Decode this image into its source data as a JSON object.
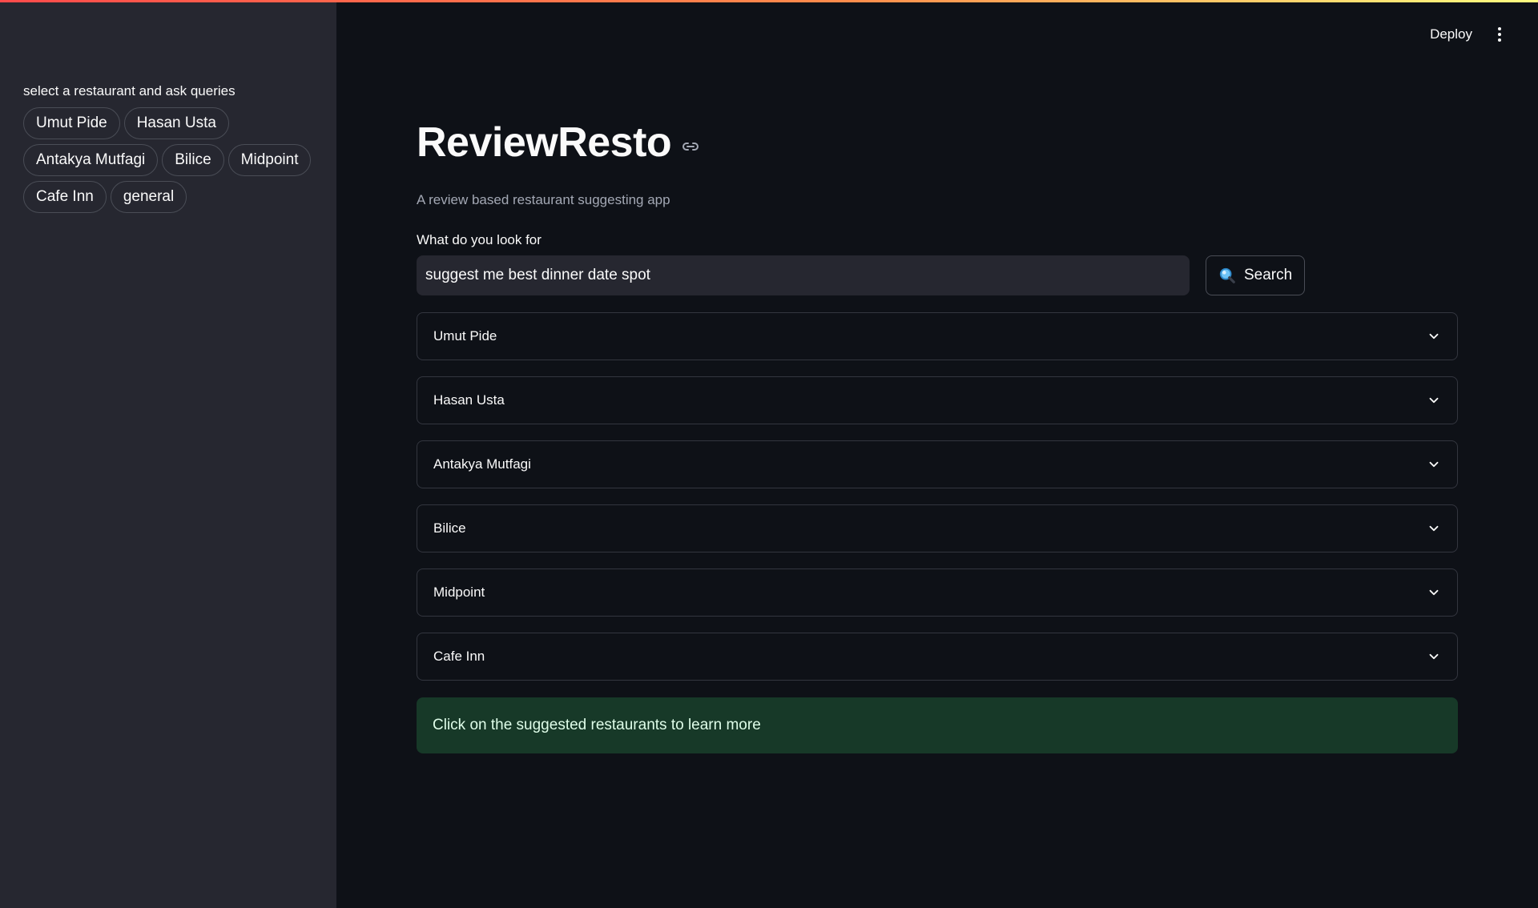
{
  "sidebar": {
    "label": "select a restaurant and ask queries",
    "pills": [
      "Umut Pide",
      "Hasan Usta",
      "Antakya Mutfagi",
      "Bilice",
      "Midpoint",
      "Cafe Inn",
      "general"
    ]
  },
  "header": {
    "deploy_label": "Deploy",
    "menu_icon": "more-vertical-icon"
  },
  "main": {
    "title": "ReviewResto",
    "title_icon": "link-icon",
    "subtitle": "A review based restaurant suggesting app",
    "query_label": "What do you look for",
    "query_value": "suggest me best dinner date spot",
    "search_label": "Search",
    "search_icon": "magnifier-icon",
    "expanders": [
      "Umut Pide",
      "Hasan Usta",
      "Antakya Mutfagi",
      "Bilice",
      "Midpoint",
      "Cafe Inn"
    ],
    "info_message": "Click on the suggested restaurants to learn more"
  },
  "colors": {
    "background": "#0e1117",
    "sidebar": "#262730",
    "success_bg": "#173928",
    "success_text": "#dffde9",
    "accent_gradient_start": "#ff4b4b",
    "accent_gradient_end": "#fffd80"
  }
}
